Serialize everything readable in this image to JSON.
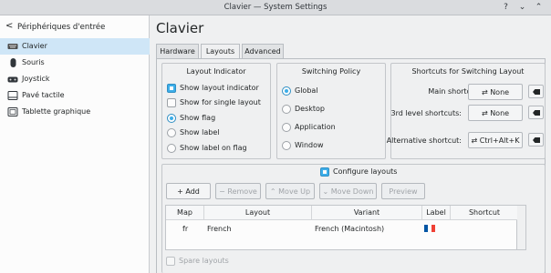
{
  "window": {
    "title": "Clavier — System Settings"
  },
  "sidebar": {
    "back_label": "<",
    "title": "Périphériques d'entrée",
    "items": [
      {
        "label": "Clavier",
        "icon": "keyboard-icon",
        "active": true
      },
      {
        "label": "Souris",
        "icon": "mouse-icon"
      },
      {
        "label": "Joystick",
        "icon": "gamepad-icon"
      },
      {
        "label": "Pavé tactile",
        "icon": "touchpad-icon"
      },
      {
        "label": "Tablette graphique",
        "icon": "tablet-icon"
      }
    ]
  },
  "main": {
    "title": "Clavier",
    "tabs": [
      {
        "label": "Hardware"
      },
      {
        "label": "Layouts"
      },
      {
        "label": "Advanced"
      }
    ],
    "layout_indicator": {
      "title": "Layout Indicator",
      "show_layout_indicator": "Show layout indicator",
      "show_for_single_layout": "Show for single layout",
      "show_flag": "Show flag",
      "show_label": "Show label",
      "show_label_on_flag": "Show label on flag"
    },
    "switching_policy": {
      "title": "Switching Policy",
      "options": [
        "Global",
        "Desktop",
        "Application",
        "Window"
      ],
      "selected": "Global"
    },
    "shortcuts": {
      "title": "Shortcuts for Switching Layout",
      "main_label": "Main shortcuts:",
      "main_value": "None",
      "third_label": "3rd level shortcuts:",
      "third_value": "None",
      "alt_label": "Alternative shortcut:",
      "alt_value": "Ctrl+Alt+K"
    },
    "configure_layouts": {
      "label": "Configure layouts",
      "buttons": {
        "add": "Add",
        "remove": "Remove",
        "move_up": "Move Up",
        "move_down": "Move Down",
        "preview": "Preview"
      },
      "columns": [
        "Map",
        "Layout",
        "Variant",
        "Label",
        "Shortcut"
      ],
      "rows": [
        {
          "map": "fr",
          "layout": "French",
          "variant": "French (Macintosh)",
          "label_flag": "fr",
          "shortcut": ""
        }
      ],
      "spare_layouts": "Spare layouts"
    }
  },
  "colors": {
    "accent": "#3daee9",
    "selection_bg": "#cfe6f7",
    "flag_blue": "#0055a4",
    "flag_white": "#ffffff",
    "flag_red": "#ef4135"
  }
}
